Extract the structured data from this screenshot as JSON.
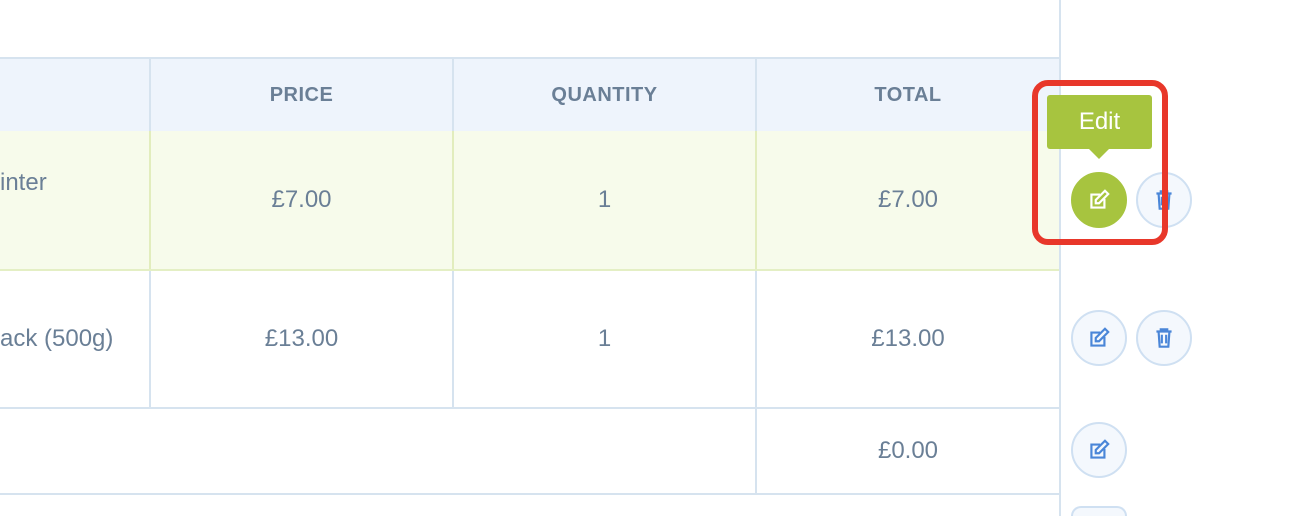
{
  "table": {
    "headers": {
      "price": "PRICE",
      "quantity": "QUANTITY",
      "total": "TOTAL"
    },
    "rows": [
      {
        "name": "inter",
        "price": "£7.00",
        "quantity": "1",
        "total": "£7.00"
      },
      {
        "name": "ack (500g)",
        "price": "£13.00",
        "quantity": "1",
        "total": "£13.00"
      },
      {
        "total": "£0.00"
      }
    ]
  },
  "tooltip": {
    "label": "Edit"
  },
  "icons": {
    "edit": "edit-icon",
    "delete": "trash-icon"
  },
  "colors": {
    "accent": "#a7c43f",
    "highlight": "#e8372a",
    "header_bg": "#eef4fc",
    "selected_row_bg": "#f7fbeb"
  }
}
